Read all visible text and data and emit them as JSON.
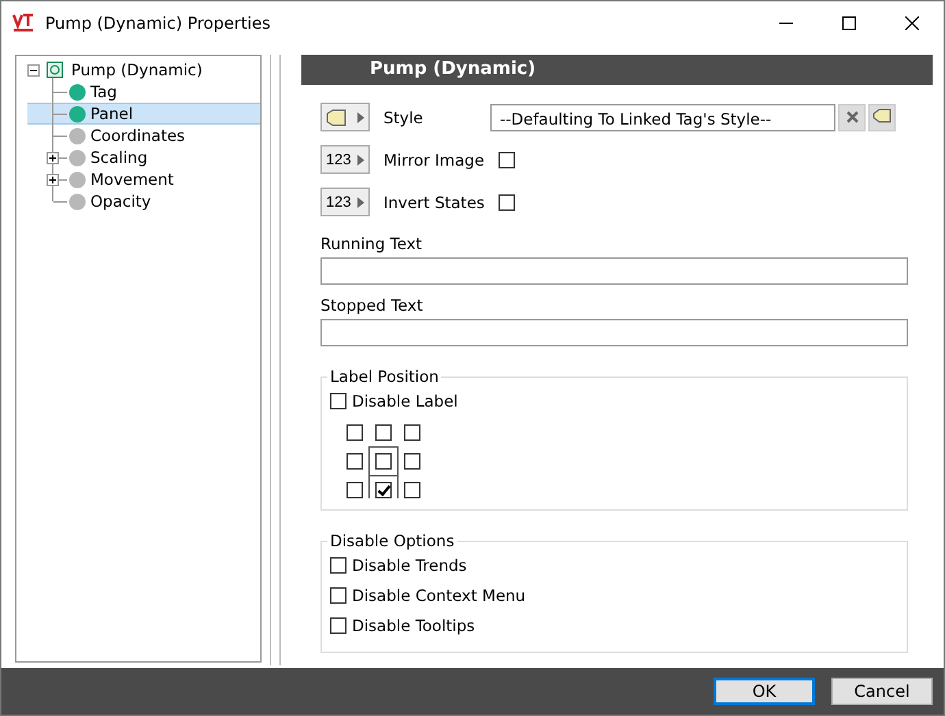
{
  "window": {
    "title": "Pump (Dynamic) Properties"
  },
  "tree": {
    "label": "Pump (Dynamic)",
    "expanded": true,
    "children": [
      {
        "label": "Tag",
        "color": "#1fb08a",
        "selected": false,
        "expandable": false
      },
      {
        "label": "Panel",
        "color": "#1fb08a",
        "selected": true,
        "expandable": false
      },
      {
        "label": "Coordinates",
        "color": "#b8b8b8",
        "selected": false,
        "expandable": false
      },
      {
        "label": "Scaling",
        "color": "#b8b8b8",
        "selected": false,
        "expandable": true
      },
      {
        "label": "Movement",
        "color": "#b8b8b8",
        "selected": false,
        "expandable": true
      },
      {
        "label": "Opacity",
        "color": "#b8b8b8",
        "selected": false,
        "expandable": false
      }
    ]
  },
  "panel": {
    "title": "Pump (Dynamic)",
    "properties": [
      {
        "kind": "style",
        "label": "Style",
        "value": "--Defaulting To Linked Tag's Style--"
      },
      {
        "kind": "checkbox",
        "icon": "123",
        "label": "Mirror Image",
        "checked": false
      },
      {
        "kind": "checkbox",
        "icon": "123",
        "label": "Invert States",
        "checked": false
      }
    ],
    "text_fields": [
      {
        "label": "Running Text"
      },
      {
        "label": "Stopped Text"
      }
    ],
    "label_position": {
      "title": "Label Position",
      "disable_label": {
        "label": "Disable Label",
        "checked": false
      },
      "positions": [
        {
          "checked": false
        },
        {
          "checked": false
        },
        {
          "checked": false
        },
        {
          "checked": false
        },
        {
          "checked": false
        },
        {
          "checked": false
        },
        {
          "checked": false
        },
        {
          "checked": true
        },
        {
          "checked": false
        }
      ]
    },
    "disable_options": {
      "title": "Disable Options",
      "items": [
        {
          "label": "Disable Trends",
          "checked": false
        },
        {
          "label": "Disable Context Menu",
          "checked": false
        },
        {
          "label": "Disable Tooltips",
          "checked": false
        }
      ]
    }
  },
  "buttons": [
    {
      "label": "OK",
      "default": true
    },
    {
      "label": "Cancel",
      "default": false
    }
  ]
}
